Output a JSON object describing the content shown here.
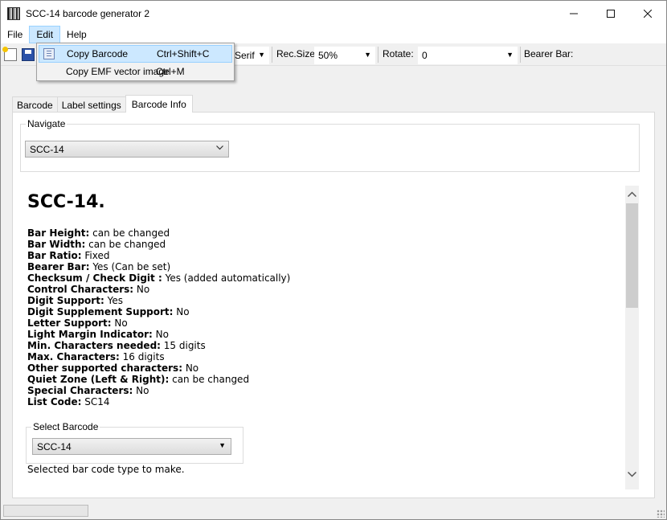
{
  "window": {
    "title": "SCC-14 barcode generator 2"
  },
  "menu": {
    "items": [
      "File",
      "Edit",
      "Help"
    ]
  },
  "edit_menu": {
    "items": [
      {
        "label": "Copy Barcode",
        "shortcut": "Ctrl+Shift+C"
      },
      {
        "label": "Copy EMF vector image",
        "shortcut": "Ctrl+M"
      }
    ]
  },
  "toolbar": {
    "font_value": "Serif",
    "rec_size_label": "Rec.Size",
    "rec_size_value": "50%",
    "rotate_label": "Rotate:",
    "rotate_value": "0",
    "bearer_bar_label": "Bearer Bar:"
  },
  "tabs": [
    "Barcode",
    "Label settings",
    "Barcode Info"
  ],
  "navigate": {
    "title": "Navigate",
    "selected": "SCC-14"
  },
  "info": {
    "title": "SCC-14.",
    "properties": [
      {
        "label": "Bar Height:",
        "value": " can be changed"
      },
      {
        "label": "Bar Width:",
        "value": " can be changed"
      },
      {
        "label": "Bar Ratio:",
        "value": " Fixed"
      },
      {
        "label": "Bearer Bar:",
        "value": " Yes (Can be set)"
      },
      {
        "label": "Checksum / Check Digit :",
        "value": " Yes (added automatically)"
      },
      {
        "label": "Control Characters:",
        "value": " No"
      },
      {
        "label": "Digit Support:",
        "value": " Yes"
      },
      {
        "label": "Digit Supplement Support:",
        "value": " No"
      },
      {
        "label": "Letter Support:",
        "value": " No"
      },
      {
        "label": "Light Margin Indicator:",
        "value": " No"
      },
      {
        "label": "Min. Characters needed:",
        "value": " 15 digits"
      },
      {
        "label": "Max. Characters:",
        "value": " 16 digits"
      },
      {
        "label": "Other supported characters:",
        "value": " No"
      },
      {
        "label": "Quiet Zone (Left & Right):",
        "value": " can be changed"
      },
      {
        "label": "Special Characters:",
        "value": " No"
      },
      {
        "label": "List Code:",
        "value": " SC14"
      }
    ],
    "select_barcode": {
      "title": "Select Barcode",
      "selected": "SCC-14"
    },
    "note": "Selected bar code type to make."
  },
  "icons": {
    "minimize": "minimize-icon",
    "maximize": "maximize-icon",
    "close": "close-icon"
  }
}
